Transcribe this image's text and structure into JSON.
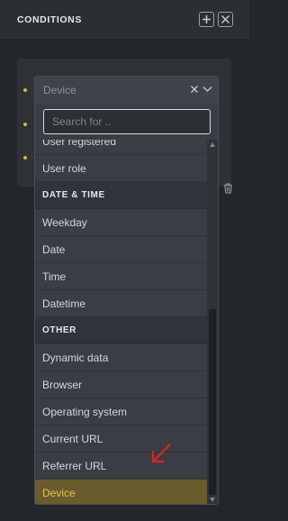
{
  "header": {
    "title": "CONDITIONS"
  },
  "icons": {
    "add": "plus-icon",
    "close": "close-icon",
    "clear": "x-icon",
    "chevron": "chevron-down-icon",
    "trash": "trash-icon"
  },
  "colors": {
    "accent": "#d4b63a",
    "active_bg": "#6b5c2e"
  },
  "select": {
    "value": "Device"
  },
  "search": {
    "placeholder": "Search for .."
  },
  "list": {
    "top_items": [
      "User registered",
      "User role"
    ],
    "group_date": "DATE & TIME",
    "date_items": [
      "Weekday",
      "Date",
      "Time",
      "Datetime"
    ],
    "group_other": "OTHER",
    "other_items": [
      "Dynamic data",
      "Browser",
      "Operating system",
      "Current URL",
      "Referrer URL",
      "Device"
    ]
  }
}
